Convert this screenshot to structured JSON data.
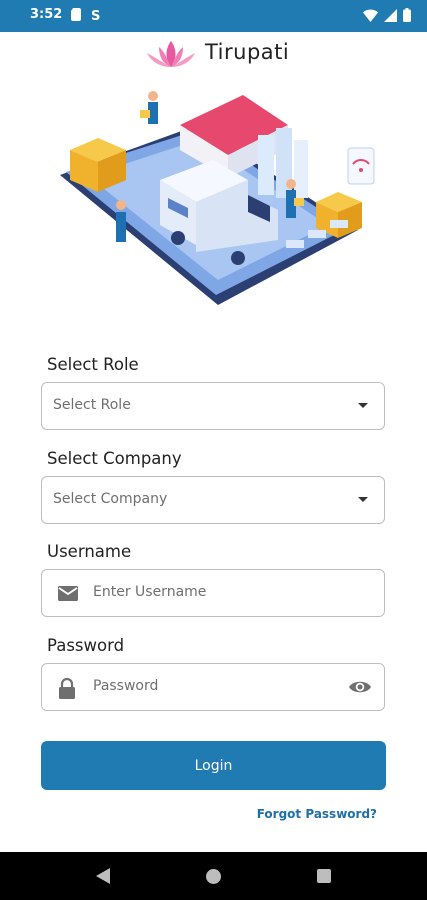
{
  "status_bar": {
    "time": "3:52",
    "left_icons": [
      "card-icon",
      "sim-icon"
    ],
    "right_icons": [
      "wifi-icon",
      "signal-icon",
      "battery-icon"
    ]
  },
  "brand": {
    "name": "Tirupati",
    "logo": "lotus-icon",
    "logo_color": "#e85aa0"
  },
  "form": {
    "role": {
      "label": "Select Role",
      "placeholder": "Select Role"
    },
    "company": {
      "label": "Select Company",
      "placeholder": "Select Company"
    },
    "username": {
      "label": "Username",
      "placeholder": "Enter Username",
      "icon": "mail-icon"
    },
    "password": {
      "label": "Password",
      "placeholder": "Password",
      "icon": "lock-icon",
      "toggle_icon": "eye-icon"
    },
    "login_label": "Login",
    "forgot_label": "Forgot Password?"
  },
  "colors": {
    "primary": "#1f7bb1",
    "link": "#1f6fa8"
  }
}
